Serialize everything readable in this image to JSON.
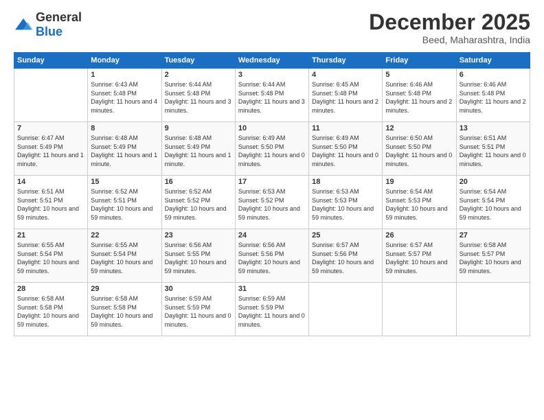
{
  "header": {
    "logo": {
      "general": "General",
      "blue": "Blue"
    },
    "title": "December 2025",
    "location": "Beed, Maharashtra, India"
  },
  "calendar": {
    "headers": [
      "Sunday",
      "Monday",
      "Tuesday",
      "Wednesday",
      "Thursday",
      "Friday",
      "Saturday"
    ],
    "weeks": [
      [
        {
          "day": "",
          "sunrise": "",
          "sunset": "",
          "daylight": ""
        },
        {
          "day": "1",
          "sunrise": "Sunrise: 6:43 AM",
          "sunset": "Sunset: 5:48 PM",
          "daylight": "Daylight: 11 hours and 4 minutes."
        },
        {
          "day": "2",
          "sunrise": "Sunrise: 6:44 AM",
          "sunset": "Sunset: 5:48 PM",
          "daylight": "Daylight: 11 hours and 3 minutes."
        },
        {
          "day": "3",
          "sunrise": "Sunrise: 6:44 AM",
          "sunset": "Sunset: 5:48 PM",
          "daylight": "Daylight: 11 hours and 3 minutes."
        },
        {
          "day": "4",
          "sunrise": "Sunrise: 6:45 AM",
          "sunset": "Sunset: 5:48 PM",
          "daylight": "Daylight: 11 hours and 2 minutes."
        },
        {
          "day": "5",
          "sunrise": "Sunrise: 6:46 AM",
          "sunset": "Sunset: 5:48 PM",
          "daylight": "Daylight: 11 hours and 2 minutes."
        },
        {
          "day": "6",
          "sunrise": "Sunrise: 6:46 AM",
          "sunset": "Sunset: 5:48 PM",
          "daylight": "Daylight: 11 hours and 2 minutes."
        }
      ],
      [
        {
          "day": "7",
          "sunrise": "Sunrise: 6:47 AM",
          "sunset": "Sunset: 5:49 PM",
          "daylight": "Daylight: 11 hours and 1 minute."
        },
        {
          "day": "8",
          "sunrise": "Sunrise: 6:48 AM",
          "sunset": "Sunset: 5:49 PM",
          "daylight": "Daylight: 11 hours and 1 minute."
        },
        {
          "day": "9",
          "sunrise": "Sunrise: 6:48 AM",
          "sunset": "Sunset: 5:49 PM",
          "daylight": "Daylight: 11 hours and 1 minute."
        },
        {
          "day": "10",
          "sunrise": "Sunrise: 6:49 AM",
          "sunset": "Sunset: 5:50 PM",
          "daylight": "Daylight: 11 hours and 0 minutes."
        },
        {
          "day": "11",
          "sunrise": "Sunrise: 6:49 AM",
          "sunset": "Sunset: 5:50 PM",
          "daylight": "Daylight: 11 hours and 0 minutes."
        },
        {
          "day": "12",
          "sunrise": "Sunrise: 6:50 AM",
          "sunset": "Sunset: 5:50 PM",
          "daylight": "Daylight: 11 hours and 0 minutes."
        },
        {
          "day": "13",
          "sunrise": "Sunrise: 6:51 AM",
          "sunset": "Sunset: 5:51 PM",
          "daylight": "Daylight: 11 hours and 0 minutes."
        }
      ],
      [
        {
          "day": "14",
          "sunrise": "Sunrise: 6:51 AM",
          "sunset": "Sunset: 5:51 PM",
          "daylight": "Daylight: 10 hours and 59 minutes."
        },
        {
          "day": "15",
          "sunrise": "Sunrise: 6:52 AM",
          "sunset": "Sunset: 5:51 PM",
          "daylight": "Daylight: 10 hours and 59 minutes."
        },
        {
          "day": "16",
          "sunrise": "Sunrise: 6:52 AM",
          "sunset": "Sunset: 5:52 PM",
          "daylight": "Daylight: 10 hours and 59 minutes."
        },
        {
          "day": "17",
          "sunrise": "Sunrise: 6:53 AM",
          "sunset": "Sunset: 5:52 PM",
          "daylight": "Daylight: 10 hours and 59 minutes."
        },
        {
          "day": "18",
          "sunrise": "Sunrise: 6:53 AM",
          "sunset": "Sunset: 5:53 PM",
          "daylight": "Daylight: 10 hours and 59 minutes."
        },
        {
          "day": "19",
          "sunrise": "Sunrise: 6:54 AM",
          "sunset": "Sunset: 5:53 PM",
          "daylight": "Daylight: 10 hours and 59 minutes."
        },
        {
          "day": "20",
          "sunrise": "Sunrise: 6:54 AM",
          "sunset": "Sunset: 5:54 PM",
          "daylight": "Daylight: 10 hours and 59 minutes."
        }
      ],
      [
        {
          "day": "21",
          "sunrise": "Sunrise: 6:55 AM",
          "sunset": "Sunset: 5:54 PM",
          "daylight": "Daylight: 10 hours and 59 minutes."
        },
        {
          "day": "22",
          "sunrise": "Sunrise: 6:55 AM",
          "sunset": "Sunset: 5:54 PM",
          "daylight": "Daylight: 10 hours and 59 minutes."
        },
        {
          "day": "23",
          "sunrise": "Sunrise: 6:56 AM",
          "sunset": "Sunset: 5:55 PM",
          "daylight": "Daylight: 10 hours and 59 minutes."
        },
        {
          "day": "24",
          "sunrise": "Sunrise: 6:56 AM",
          "sunset": "Sunset: 5:56 PM",
          "daylight": "Daylight: 10 hours and 59 minutes."
        },
        {
          "day": "25",
          "sunrise": "Sunrise: 6:57 AM",
          "sunset": "Sunset: 5:56 PM",
          "daylight": "Daylight: 10 hours and 59 minutes."
        },
        {
          "day": "26",
          "sunrise": "Sunrise: 6:57 AM",
          "sunset": "Sunset: 5:57 PM",
          "daylight": "Daylight: 10 hours and 59 minutes."
        },
        {
          "day": "27",
          "sunrise": "Sunrise: 6:58 AM",
          "sunset": "Sunset: 5:57 PM",
          "daylight": "Daylight: 10 hours and 59 minutes."
        }
      ],
      [
        {
          "day": "28",
          "sunrise": "Sunrise: 6:58 AM",
          "sunset": "Sunset: 5:58 PM",
          "daylight": "Daylight: 10 hours and 59 minutes."
        },
        {
          "day": "29",
          "sunrise": "Sunrise: 6:58 AM",
          "sunset": "Sunset: 5:58 PM",
          "daylight": "Daylight: 10 hours and 59 minutes."
        },
        {
          "day": "30",
          "sunrise": "Sunrise: 6:59 AM",
          "sunset": "Sunset: 5:59 PM",
          "daylight": "Daylight: 11 hours and 0 minutes."
        },
        {
          "day": "31",
          "sunrise": "Sunrise: 6:59 AM",
          "sunset": "Sunset: 5:59 PM",
          "daylight": "Daylight: 11 hours and 0 minutes."
        },
        {
          "day": "",
          "sunrise": "",
          "sunset": "",
          "daylight": ""
        },
        {
          "day": "",
          "sunrise": "",
          "sunset": "",
          "daylight": ""
        },
        {
          "day": "",
          "sunrise": "",
          "sunset": "",
          "daylight": ""
        }
      ]
    ]
  }
}
